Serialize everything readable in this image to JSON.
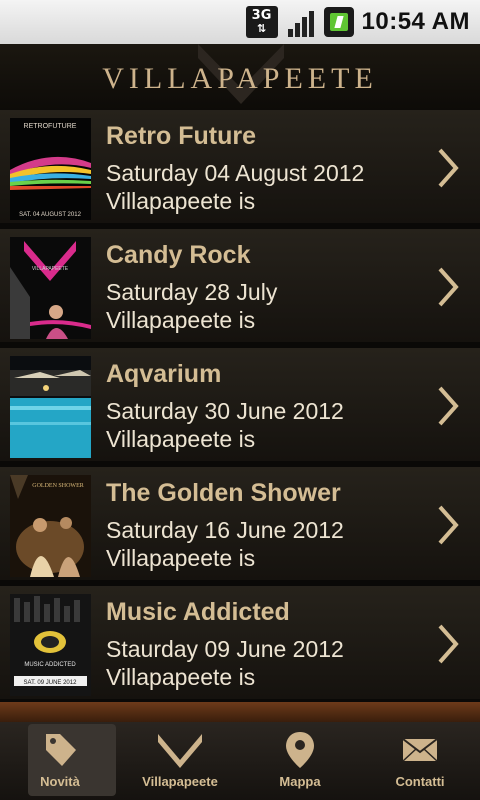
{
  "status_bar": {
    "network": "3G",
    "time": "10:54 AM"
  },
  "header": {
    "title": "VILLAPAPEETE"
  },
  "events": [
    {
      "title": "Retro Future",
      "date": "Saturday 04 August 2012",
      "venue": "Villapapeete is",
      "thumb_text": "RETROFUTURE",
      "thumb_caption": "SAT. 04 AUGUST 2012"
    },
    {
      "title": "Candy Rock",
      "date": "Saturday 28 July",
      "venue": "Villapapeete is",
      "thumb_text": "VILLAPAPEETE"
    },
    {
      "title": "Aqvarium",
      "date": "Saturday 30 June 2012",
      "venue": "Villapapeete is"
    },
    {
      "title": "The Golden Shower",
      "date": "Saturday 16 June 2012",
      "venue": "Villapapeete is",
      "thumb_text": "GOLDEN SHOWER"
    },
    {
      "title": "Music Addicted",
      "date": "Staurday 09 June 2012",
      "venue": "Villapapeete is",
      "thumb_text": "MUSIC ADDICTED",
      "thumb_caption": "SAT. 09 JUNE 2012"
    }
  ],
  "tabs": [
    {
      "label": "Novità",
      "icon": "tag-icon",
      "active": true
    },
    {
      "label": "Villapapeete",
      "icon": "v-logo-icon",
      "active": false
    },
    {
      "label": "Mappa",
      "icon": "map-pin-icon",
      "active": false
    },
    {
      "label": "Contatti",
      "icon": "envelope-icon",
      "active": false
    }
  ],
  "colors": {
    "accent": "#d4bd94",
    "text": "#ede4d2",
    "background": "#0d0b08"
  }
}
